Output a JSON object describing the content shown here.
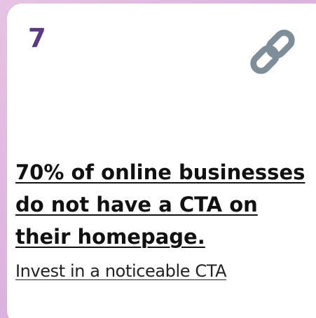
{
  "card": {
    "number": "7",
    "icon": "link-icon",
    "headline_lines": [
      "70% of online businesses",
      "do not have a CTA on",
      "their homepage."
    ],
    "link_text": "Invest in a noticeable CTA"
  },
  "colors": {
    "background_gradient": [
      "#e6c3e4",
      "#cfa3d6"
    ],
    "card_background": "#ffffff",
    "number": "#5b3b7f",
    "icon": "#7e8d97",
    "text": "#111111"
  }
}
